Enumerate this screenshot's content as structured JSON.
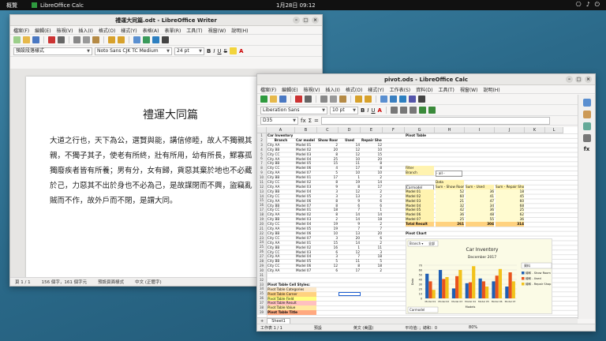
{
  "topbar": {
    "activities": "概覽",
    "app": "LibreOffice Calc",
    "clock": "1月28日 09:12"
  },
  "writer": {
    "title": "禮運大同篇.odt - LibreOffice Writer",
    "menu": [
      "檔案(F)",
      "編輯(E)",
      "檢視(V)",
      "插入(I)",
      "格式(O)",
      "樣式(Y)",
      "表格(A)",
      "表單(R)",
      "工具(T)",
      "視窗(W)",
      "說明(H)"
    ],
    "style": "預設段落樣式",
    "font": "Noto Sans CJK TC Medium",
    "size": "24 pt",
    "doc_title": "禮運大同篇",
    "doc_body": "大道之行也，天下為公，選賢與能，講信修睦，故人不獨親其\n親，不獨子其子，使老有所終，壯有所用，幼有所長，鰥寡孤\n獨廢疾者皆有所養；男有分，女有歸，貨惡其棄於地也不必藏\n於己，力惡其不出於身也不必為己，是故謀閉而不興，盜竊亂\n賊而不作，故外戶而不閉，是謂大同。",
    "status": {
      "page": "頁 1 / 1",
      "words": "156 個字，161 個字元",
      "style": "預設頁面樣式",
      "lang": "中文 (正體字)"
    }
  },
  "calc": {
    "title": "pivot.ods - LibreOffice Calc",
    "menu": [
      "檔案(F)",
      "編輯(E)",
      "檢視(V)",
      "插入(I)",
      "格式(O)",
      "樣式(Y)",
      "工作表(S)",
      "資料(D)",
      "工具(T)",
      "視窗(W)",
      "說明(H)"
    ],
    "font": "Liberation Sans",
    "size": "10 pt",
    "cellref": "D35",
    "columns": [
      "A",
      "B",
      "C",
      "D",
      "E",
      "F",
      "G",
      "H",
      "I",
      "J",
      "K",
      "L"
    ],
    "sheet_tab": "Sheet1",
    "status": {
      "sheet": "工作表 1 / 1",
      "mode": "預設",
      "lang": "英文 (美國)",
      "sum": "平均值：；總和：0",
      "zoom": "80%"
    },
    "cells": {
      "a1": "Car Inventory",
      "a2": "Branch",
      "b2": "Car model",
      "c2": "Show Room",
      "d2": "Used",
      "e2": "Repair Shop",
      "g1": "Pivot Table",
      "g8": "Filter",
      "g9": "Branch",
      "h9": "- all -",
      "hdr_carmodel": "Carmodel",
      "hdr_data": "Data",
      "hdr_show": "Sum - Show Room",
      "hdr_used": "Sum - Used",
      "hdr_repair": "Sum - Repair Shop",
      "g17": "Total Result",
      "g19": "Pivot Chart",
      "a33": "Pivot Table Cell Styles:",
      "a34": "Pivot Table Categories",
      "a35": "Pivot Table Corner",
      "a36": "Pivot Table Field",
      "a37": "Pivot Table Result",
      "a38": "Pivot Table Value",
      "a39": "Pivot Table Title"
    },
    "rows": [
      [
        "City AA",
        "Model 01",
        "2",
        "14",
        "12"
      ],
      [
        "City BB",
        "Model 02",
        "20",
        "12",
        "10"
      ],
      [
        "City CC",
        "Model 03",
        "8",
        "12",
        "15"
      ],
      [
        "City AA",
        "Model 04",
        "25",
        "10",
        "20"
      ],
      [
        "City BB",
        "Model 05",
        "15",
        "11",
        "8"
      ],
      [
        "City CC",
        "Model 06",
        "4",
        "17",
        "8"
      ],
      [
        "City AA",
        "Model 07",
        "5",
        "10",
        "10"
      ],
      [
        "City BB",
        "Model 01",
        "17",
        "1",
        "2"
      ],
      [
        "City CC",
        "Model 02",
        "8",
        "19",
        "14"
      ],
      [
        "City AA",
        "Model 03",
        "9",
        "8",
        "17"
      ],
      [
        "City BB",
        "Model 04",
        "3",
        "12",
        "2"
      ],
      [
        "City CC",
        "Model 05",
        "3",
        "13",
        "2"
      ],
      [
        "City AA",
        "Model 06",
        "8",
        "9",
        "6"
      ],
      [
        "City BB",
        "Model 07",
        "8",
        "6",
        "6"
      ],
      [
        "City CC",
        "Model 01",
        "18",
        "7",
        "1"
      ],
      [
        "City AA",
        "Model 02",
        "8",
        "14",
        "14"
      ],
      [
        "City BB",
        "Model 03",
        "2",
        "14",
        "18"
      ],
      [
        "City CC",
        "Model 04",
        "19",
        "9",
        "2"
      ],
      [
        "City AA",
        "Model 05",
        "19",
        "7",
        "7"
      ],
      [
        "City BB",
        "Model 06",
        "10",
        "13",
        "20"
      ],
      [
        "City CC",
        "Model 07",
        "3",
        "20",
        "6"
      ],
      [
        "City AA",
        "Model 01",
        "15",
        "14",
        "2"
      ],
      [
        "City BB",
        "Model 02",
        "16",
        "1",
        "11"
      ],
      [
        "City CC",
        "Model 03",
        "6",
        "12",
        "3"
      ],
      [
        "City AA",
        "Model 04",
        "3",
        "7",
        "18"
      ],
      [
        "City BB",
        "Model 05",
        "5",
        "11",
        "5"
      ],
      [
        "City CC",
        "Model 06",
        "12",
        "8",
        "18"
      ],
      [
        "City AA",
        "Model 07",
        "6",
        "17",
        "2"
      ]
    ],
    "pivot": [
      [
        "Model 01",
        "52",
        "36",
        "18"
      ],
      [
        "Model 02",
        "60",
        "41",
        "45"
      ],
      [
        "Model 03",
        "21",
        "47",
        "60"
      ],
      [
        "Model 04",
        "32",
        "34",
        "68"
      ],
      [
        "Model 05",
        "42",
        "36",
        "25"
      ],
      [
        "Model 06",
        "36",
        "48",
        "62"
      ],
      [
        "Model 07",
        "25",
        "55",
        "36"
      ]
    ],
    "pivot_total": [
      "261",
      "304",
      "314"
    ]
  },
  "chart_data": {
    "type": "bar",
    "title": "Car Inventory",
    "subtitle": "December 2017",
    "filter_label": "Branch ▾",
    "filter_value": "全部",
    "legend_title": "資料",
    "categories": [
      "Model 01",
      "Model 02",
      "Model 03",
      "Model 04",
      "Model 05",
      "Model 06",
      "Model 07"
    ],
    "series": [
      {
        "name": "總和 - Show Room",
        "color": "#1f5fb4",
        "values": [
          52,
          60,
          21,
          32,
          42,
          36,
          25
        ]
      },
      {
        "name": "總和 - Used",
        "color": "#e8541e",
        "values": [
          36,
          41,
          47,
          34,
          36,
          48,
          55
        ]
      },
      {
        "name": "總和 - Repair Shop",
        "color": "#f2c21b",
        "values": [
          18,
          45,
          60,
          68,
          25,
          62,
          36
        ]
      }
    ],
    "ylim": [
      0,
      70
    ],
    "yticks": [
      "0",
      "10",
      "20",
      "30",
      "40",
      "50",
      "60",
      "70"
    ],
    "ylabel": "Data",
    "xlabel": "Models",
    "field_button": "Carmodel"
  }
}
